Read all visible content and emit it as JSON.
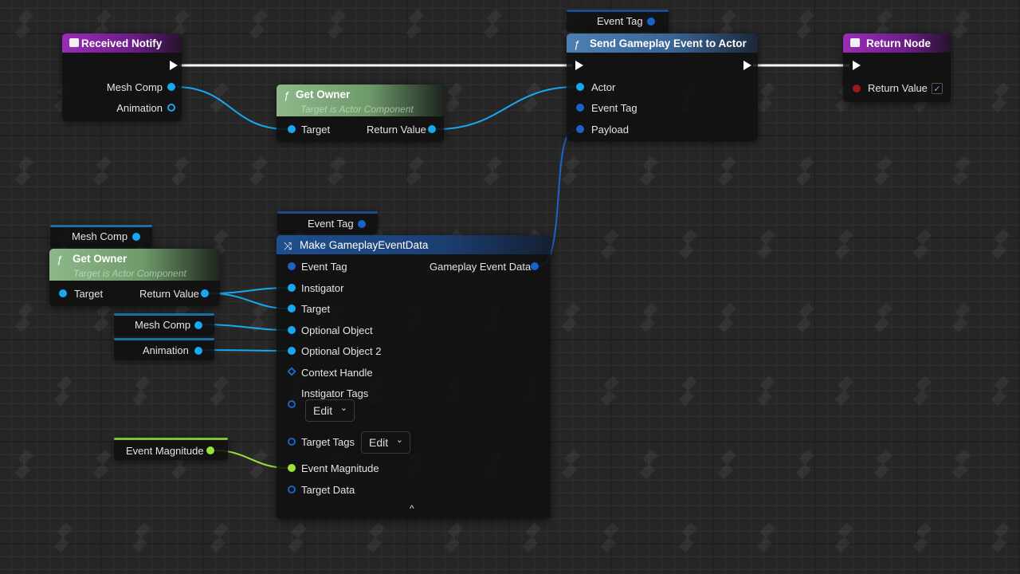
{
  "colors": {
    "exec_wire": "#ffffff",
    "object_pin": "#17a8f2",
    "struct_pin": "#1a63c9",
    "float_pin": "#9be23a",
    "bool_pin": "#9e1a1a"
  },
  "received_notify": {
    "title": "Received Notify",
    "pins": [
      "Mesh Comp",
      "Animation"
    ]
  },
  "get_owner_top": {
    "title": "Get Owner",
    "subtitle": "Target is Actor Component",
    "target": "Target",
    "return": "Return Value"
  },
  "send_event": {
    "title": "Send Gameplay Event to Actor",
    "top_var": "Event Tag",
    "pins": [
      "Actor",
      "Event Tag",
      "Payload"
    ]
  },
  "return_node": {
    "title": "Return Node",
    "return": "Return Value",
    "checked": "✓"
  },
  "mesh_comp_var_left": "Mesh Comp",
  "get_owner_left": {
    "title": "Get Owner",
    "subtitle": "Target is Actor Component",
    "target": "Target",
    "return": "Return Value"
  },
  "event_tag_var": "Event Tag",
  "make_event_data": {
    "title": "Make GameplayEventData",
    "output": "Gameplay Event Data",
    "pins": [
      "Event Tag",
      "Instigator",
      "Target",
      "Optional Object",
      "Optional Object 2",
      "Context Handle",
      "Instigator Tags",
      "Target Tags",
      "Event Magnitude",
      "Target Data"
    ],
    "edit_label": "Edit",
    "collapse_icon": "^"
  },
  "mesh_comp_var": "Mesh Comp",
  "animation_var": "Animation",
  "event_magnitude_var": "Event Magnitude"
}
